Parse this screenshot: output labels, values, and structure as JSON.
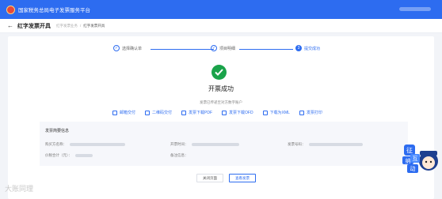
{
  "header": {
    "app_title": "国家税务总局电子发票服务平台"
  },
  "subheader": {
    "back_glyph": "←",
    "page_title": "红字发票开具",
    "breadcrumb": [
      "红字发票业务",
      "红字发票开具"
    ],
    "breadcrumb_sep": "/"
  },
  "steps": [
    {
      "label": "选择确认单",
      "marker": "✓"
    },
    {
      "label": "项目明细",
      "marker": "✓"
    },
    {
      "label": "提交成功",
      "marker": "3"
    }
  ],
  "result": {
    "title": "开票成功",
    "description": "发票已传递至对方数字账户"
  },
  "actions": [
    {
      "label": "邮箱交付",
      "icon": "mail-icon"
    },
    {
      "label": "二维码交付",
      "icon": "qrcode-icon"
    },
    {
      "label": "发票下载PDF",
      "icon": "download-icon"
    },
    {
      "label": "发票下载OFD",
      "icon": "download-icon"
    },
    {
      "label": "下载为XML",
      "icon": "download-icon"
    },
    {
      "label": "发票打印",
      "icon": "print-icon"
    }
  ],
  "summary": {
    "title": "发票简要信息",
    "fields": [
      {
        "label": "购买方名称："
      },
      {
        "label": "开票时间："
      },
      {
        "label": "发票号码："
      },
      {
        "label": "价税合计（元）："
      },
      {
        "label": "备注信息："
      }
    ]
  },
  "buttons": {
    "close": "关闭页面",
    "view": "查看发票"
  },
  "watermark": "大账同理",
  "mascot_text": [
    "征",
    "纳",
    "互",
    "动"
  ],
  "colors": {
    "primary": "#2d6cf0",
    "success": "#1aa34a"
  }
}
